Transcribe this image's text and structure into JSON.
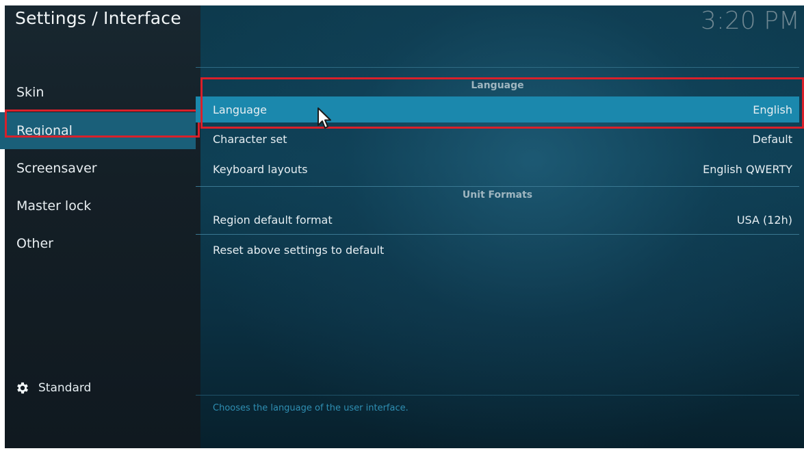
{
  "header": {
    "title": "Settings / Interface",
    "clock": "3:20 PM"
  },
  "sidebar": {
    "items": [
      {
        "label": "Skin",
        "active": false
      },
      {
        "label": "Regional",
        "active": true
      },
      {
        "label": "Screensaver",
        "active": false
      },
      {
        "label": "Master lock",
        "active": false
      },
      {
        "label": "Other",
        "active": false
      }
    ],
    "level_label": "Standard",
    "level_icon": "gear-icon"
  },
  "sections": [
    {
      "heading": "Language",
      "rows": [
        {
          "label": "Language",
          "value": "English",
          "focused": true
        },
        {
          "label": "Character set",
          "value": "Default",
          "focused": false
        },
        {
          "label": "Keyboard layouts",
          "value": "English QWERTY",
          "focused": false
        }
      ]
    },
    {
      "heading": "Unit Formats",
      "rows": [
        {
          "label": "Region default format",
          "value": "USA (12h)",
          "focused": false
        }
      ]
    }
  ],
  "reset_label": "Reset above settings to default",
  "hint": "Chooses the language of the user interface.",
  "colors": {
    "accent": "#1b88ad",
    "sidebar_active": "#1a5f79",
    "highlight_box": "#d9202a"
  }
}
